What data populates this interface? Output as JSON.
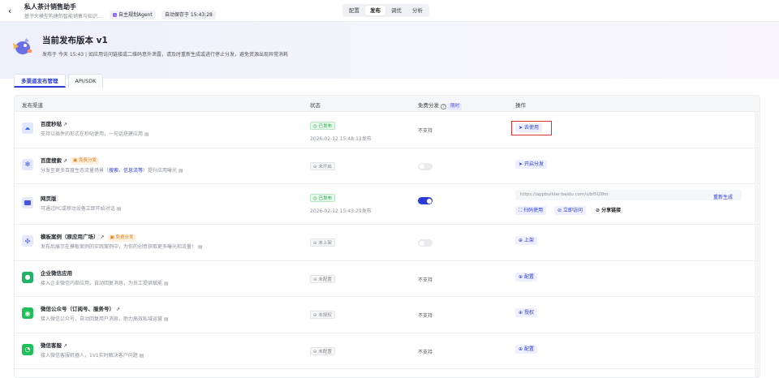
{
  "header": {
    "back_icon": "chevron-left-icon",
    "app_title": "私人茶计销售助手",
    "app_subtitle": "基于大模型构建的智能销售与知识...",
    "agent_badge": "自主规划Agent",
    "autosave": "自动保存于 15:43:28",
    "tabs": [
      "配置",
      "发布",
      "调优",
      "分析"
    ],
    "active_tab": "发布"
  },
  "hero": {
    "title": "当前发布版本 v1",
    "desc": "发布于 今天 15:43 | 如应用访问链接或二维码意外泄露，请及时重新生成或进行停止分发，避免资源出现异常消耗"
  },
  "subtabs": [
    "多渠道发布管理",
    "API/SDK"
  ],
  "table": {
    "headers": {
      "channel": "发布渠道",
      "status": "状态",
      "free": "免费分发",
      "limit": "限时",
      "action": "操作"
    },
    "rows": [
      {
        "name": "百度秒哒",
        "desc": "支持以插件的形式在秒哒使用，一句话搭建应用",
        "status": "已发布",
        "time": "2026-02-12 15:48:13发布",
        "free": "不支持",
        "action": "去使用",
        "icon": "miaoda-icon",
        "color": "#3b6cf0"
      },
      {
        "name": "百度搜索",
        "tag": "免费分发",
        "desc_a": "分发至更多百度生态流量场景（",
        "desc_hl": "搜索、信息流等",
        "desc_b": "）提升应用曝光",
        "status": "未开启",
        "action": "开启分发",
        "icon": "baidu-paw-icon",
        "color": "#3556e8"
      },
      {
        "name": "网页版",
        "desc": "可通过PC或移动设备立即开始对话",
        "status": "已发布",
        "time": "2026-02-12 15:43:29发布",
        "url": "https://appbuilder.baidu.com/s/bI5I28m",
        "regen": "重新生成",
        "btns": [
          "扫码使用",
          "立即访问",
          "分享链接"
        ],
        "icon": "web-icon",
        "color": "#4455e0"
      },
      {
        "name": "模板案例（原应用广场）",
        "tag": "免费分发",
        "desc": "发布后展示在模板案例的实践案例中，为你的创意获取更多曝光和流量！",
        "status": "未上架",
        "action": "上架",
        "icon": "template-icon",
        "color": "#3a4de6"
      },
      {
        "name": "企业微信应用",
        "desc": "接入企业微信内部应用，自动回复消息，为员工提供赋能",
        "status": "未配置",
        "free": "不支持",
        "action": "配置",
        "icon": "wecom-icon",
        "color": "#21b365"
      },
      {
        "name": "微信公众号（订阅号、服务号）",
        "desc": "接入微信公众号，自动回复用户消息，助力高效私域运营",
        "status": "未授权",
        "free": "不支持",
        "action": "授权",
        "icon": "wechat-icon",
        "color": "#1fbf5a"
      },
      {
        "name": "微信客服",
        "desc": "接入微信客服机器人，1V1实时解决客户问题",
        "status": "未配置",
        "free": "不支持",
        "action": "配置",
        "icon": "wechat-service-icon",
        "color": "#1fbf5a"
      }
    ]
  }
}
